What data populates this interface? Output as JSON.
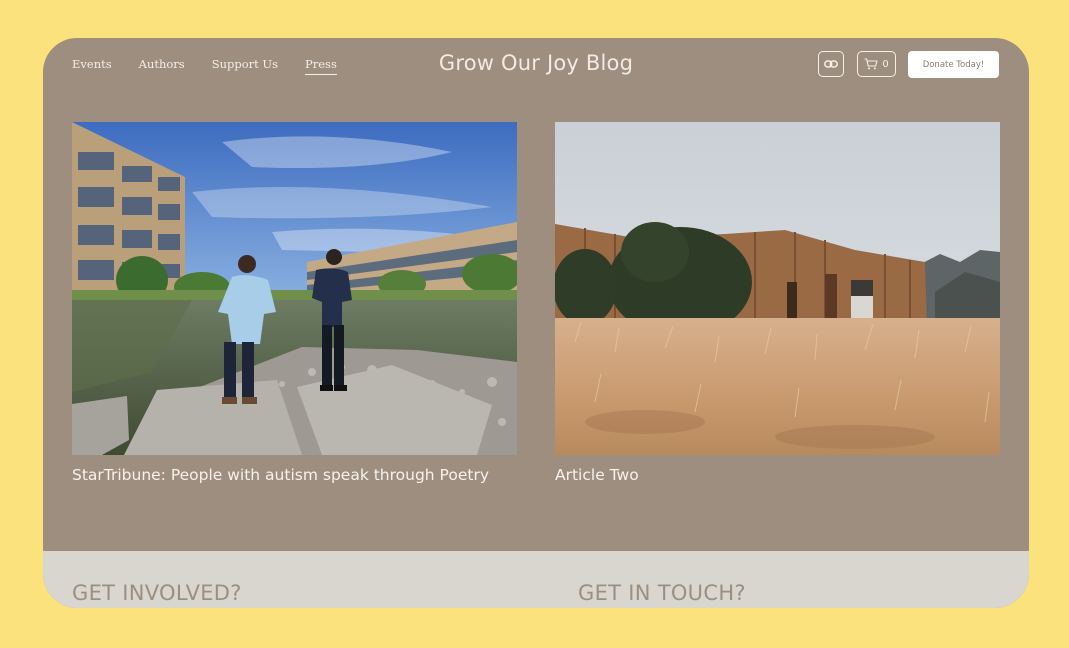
{
  "header": {
    "nav": [
      {
        "label": "Events"
      },
      {
        "label": "Authors"
      },
      {
        "label": "Support Us"
      },
      {
        "label": "Press"
      }
    ],
    "title": "Grow Our Joy Blog",
    "cart_count": "0",
    "donate_label": "Donate Today!",
    "icons": [
      "link-icon",
      "cart-icon"
    ]
  },
  "articles": [
    {
      "title": "StarTribune: People with autism speak through Poetry"
    },
    {
      "title": "Article Two"
    }
  ],
  "footer": {
    "get_involved": "GET INVOLVED?",
    "get_in_touch": "GET IN TOUCH?"
  },
  "colors": {
    "page_background": "#fbe27c",
    "panel": "#9d8e7f",
    "footer": "#d9d6d0",
    "donate_button": "#ffffff"
  }
}
